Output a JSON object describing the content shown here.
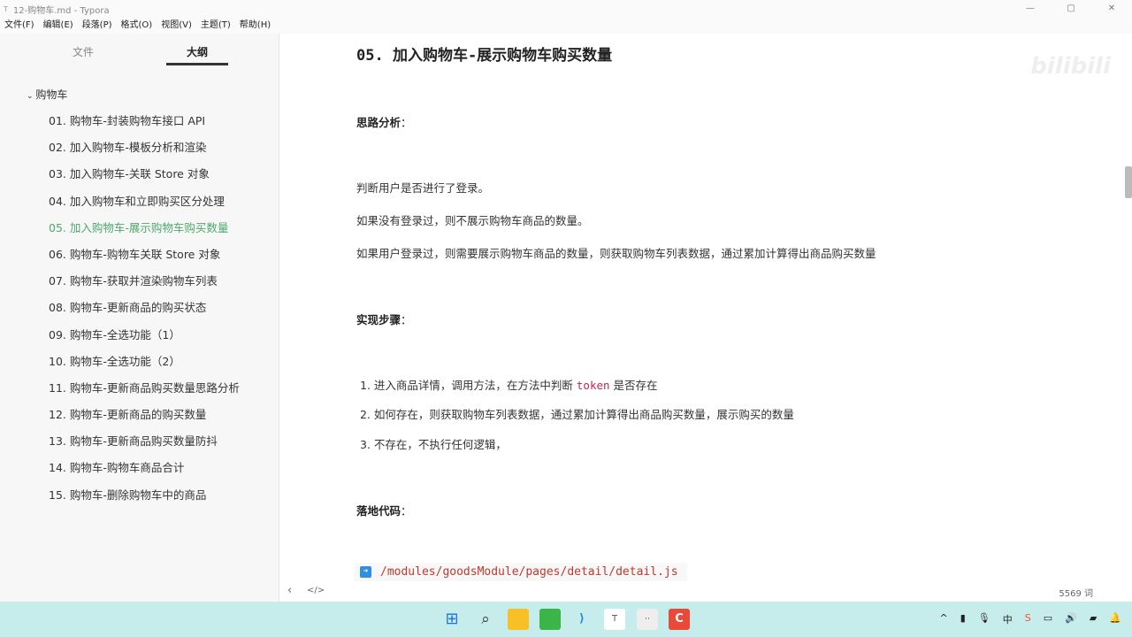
{
  "window": {
    "title": "12-购物车.md - Typora",
    "minimize": "—",
    "maximize": "▢",
    "close": "✕"
  },
  "menu": [
    "文件(F)",
    "编辑(E)",
    "段落(P)",
    "格式(O)",
    "视图(V)",
    "主题(T)",
    "帮助(H)"
  ],
  "sidebar": {
    "tabs": [
      "文件",
      "大纲"
    ],
    "root": "购物车",
    "items": [
      "01. 购物车-封装购物车接口 API",
      "02. 加入购物车-模板分析和渲染",
      "03. 加入购物车-关联 Store 对象",
      "04. 加入购物车和立即购买区分处理",
      "05. 加入购物车-展示购物车购买数量",
      "06. 购物车-购物车关联 Store 对象",
      "07. 购物车-获取并渲染购物车列表",
      "08. 购物车-更新商品的购买状态",
      "09. 购物车-全选功能（1）",
      "10. 购物车-全选功能（2）",
      "11. 购物车-更新商品购买数量思路分析",
      "12. 购物车-更新商品的购买数量",
      "13. 购物车-更新商品购买数量防抖",
      "14. 购物车-购物车商品合计",
      "15. 购物车-删除购物车中的商品"
    ],
    "active_index": 4
  },
  "doc": {
    "heading": "05. 加入购物车-展示购物车购买数量",
    "analysis_title": "思路分析",
    "analysis": [
      "判断用户是否进行了登录。",
      "如果没有登录过，则不展示购物车商品的数量。",
      "如果用户登录过，则需要展示购物车商品的数量，则获取购物车列表数据，通过累加计算得出商品购买数量"
    ],
    "steps_title": "实现步骤",
    "steps": [
      {
        "num": "1.",
        "pre": "进入商品详情，调用方法，在方法中判断 ",
        "code": "token",
        "post": " 是否存在"
      },
      {
        "num": "2.",
        "pre": "如何存在，则获取购物车列表数据，通过累加计算得出商品购买数量，展示购买的数量",
        "code": "",
        "post": ""
      },
      {
        "num": "3.",
        "pre": "不存在，不执行任何逻辑，",
        "code": "",
        "post": ""
      }
    ],
    "code_title": "落地代码",
    "file_path": "/modules/goodsModule/pages/detail/detail.js",
    "colon": "："
  },
  "footer": {
    "word_count": "5569 词",
    "back": "‹",
    "source": "</>"
  },
  "watermark": "bilibili"
}
